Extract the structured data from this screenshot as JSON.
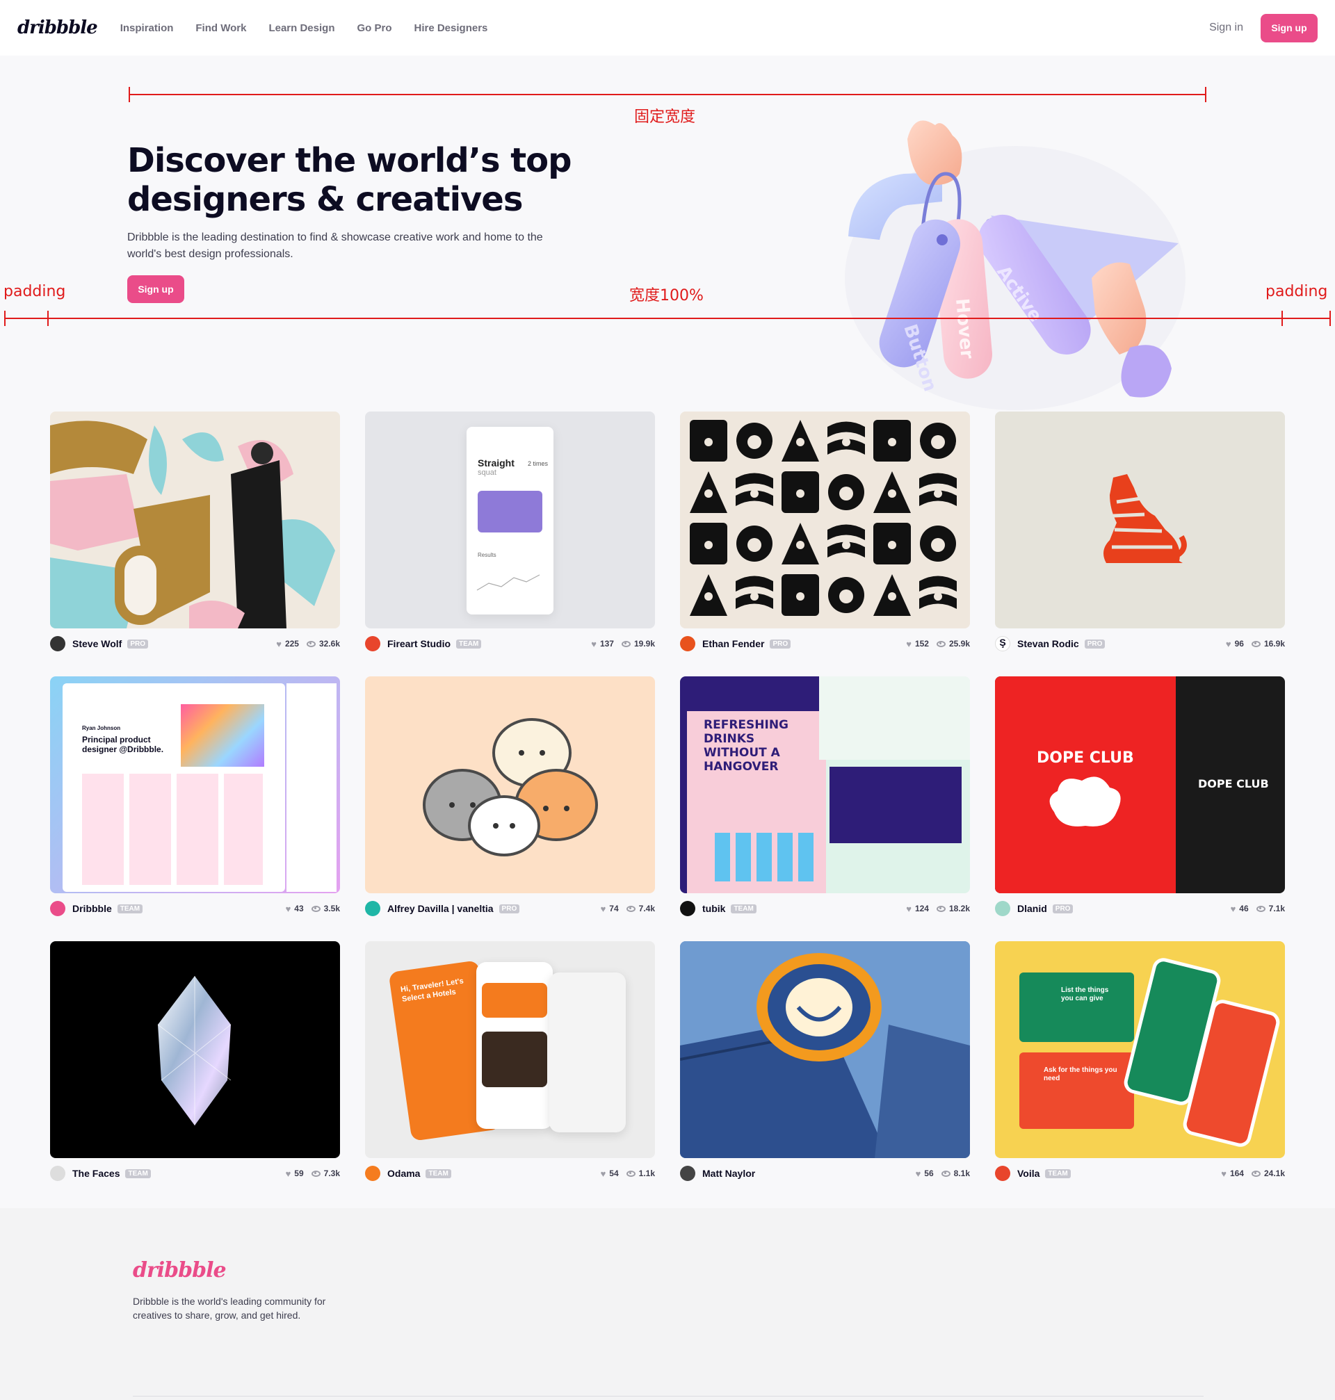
{
  "header": {
    "logo": "dribbble",
    "nav": [
      "Inspiration",
      "Find Work",
      "Learn Design",
      "Go Pro",
      "Hire Designers"
    ],
    "signin": "Sign in",
    "signup": "Sign up"
  },
  "hero": {
    "title": "Discover the world’s top designers & creatives",
    "description": "Dribbble is the leading destination to find & showcase creative work and home to the world's best design professionals.",
    "signup": "Sign up",
    "tag_labels": [
      "Button",
      "Hover",
      "Active"
    ]
  },
  "annotations": {
    "fixed_width": "固定宽度",
    "width_100": "宽度100%",
    "padding_left": "padding",
    "padding_right": "padding"
  },
  "shots": [
    {
      "author": "Steve Wolf",
      "badge": "PRO",
      "likes": "225",
      "views": "32.6k",
      "avatar_color": "#333333"
    },
    {
      "author": "Fireart Studio",
      "badge": "TEAM",
      "likes": "137",
      "views": "19.9k",
      "avatar_color": "#e8452c"
    },
    {
      "author": "Ethan Fender",
      "badge": "PRO",
      "likes": "152",
      "views": "25.9k",
      "avatar_color": "#e8521d"
    },
    {
      "author": "Stevan Rodic",
      "badge": "PRO",
      "likes": "96",
      "views": "16.9k",
      "avatar_color": "#ffffff"
    },
    {
      "author": "Dribbble",
      "badge": "TEAM",
      "likes": "43",
      "views": "3.5k",
      "avatar_color": "#ea4c89"
    },
    {
      "author": "Alfrey Davilla | vaneltia",
      "badge": "PRO",
      "likes": "74",
      "views": "7.4k",
      "avatar_color": "#1fb6a6"
    },
    {
      "author": "tubik",
      "badge": "TEAM",
      "likes": "124",
      "views": "18.2k",
      "avatar_color": "#111111"
    },
    {
      "author": "Dlanid",
      "badge": "PRO",
      "likes": "46",
      "views": "7.1k",
      "avatar_color": "#9fd8c9"
    },
    {
      "author": "The Faces",
      "badge": "TEAM",
      "likes": "59",
      "views": "7.3k",
      "avatar_color": "#dddddd"
    },
    {
      "author": "Odama",
      "badge": "TEAM",
      "likes": "54",
      "views": "1.1k",
      "avatar_color": "#f57c1f"
    },
    {
      "author": "Matt Naylor",
      "badge": "",
      "likes": "56",
      "views": "8.1k",
      "avatar_color": "#444444"
    },
    {
      "author": "Voila",
      "badge": "TEAM",
      "likes": "164",
      "views": "24.1k",
      "avatar_color": "#e8452c"
    }
  ],
  "shot_texts": {
    "straight": "Straight",
    "squat": "squat",
    "times": "2 times",
    "results": "Results",
    "dope_club": "DOPE CLUB",
    "refreshing": "REFRESHING DRINKS WITHOUT A HANGOVER",
    "principal": "Principal product designer @Dribbble.",
    "ryan": "Ryan Johnson",
    "traveler": "Hi, Traveler! Let's Select a Hotels",
    "list_things": "List the things you can give",
    "ask_things": "Ask for the things you need"
  },
  "footer": {
    "logo": "dribbble",
    "description": "Dribbble is the world's leading community for creatives to share, grow, and get hired."
  }
}
